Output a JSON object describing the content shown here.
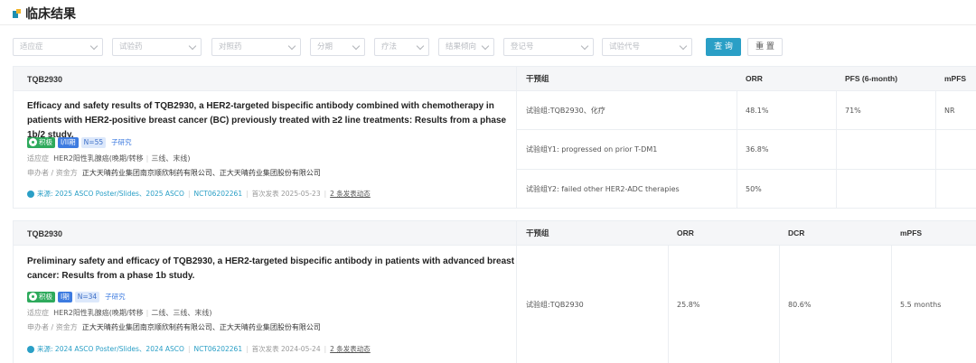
{
  "page": {
    "title": "临床结果"
  },
  "filters": [
    {
      "placeholder": "适应症"
    },
    {
      "placeholder": "试验药"
    },
    {
      "placeholder": "对照药"
    },
    {
      "placeholder": "分期"
    },
    {
      "placeholder": "疗法"
    },
    {
      "placeholder": "结果倾向"
    },
    {
      "placeholder": "登记号"
    },
    {
      "placeholder": "试验代号"
    }
  ],
  "buttons": {
    "query": "查 询",
    "reset": "重 置"
  },
  "cards": [
    {
      "drug": "TQB2930",
      "title": "Efficacy and safety results of TQB2930, a HER2-targeted bispecific antibody combined with chemotherapy in patients with HER2-positive breast cancer (BC) previously treated with ≥2 line treatments: Results from a phase 1b/2 study.",
      "tags": [
        "积极",
        "I/II期",
        "N=55",
        "子研究"
      ],
      "indication_label": "适应症",
      "indication": "HER2阳性乳腺癌(晚期/转移",
      "lines": "三线、末线)",
      "sponsor_label": "申办者 / 资金方",
      "sponsor": "正大天晴药业集团南京顺欣制药有限公司、正大天晴药业集团股份有限公司",
      "source_label": "来源:",
      "source": "2025 ASCO Poster/Slides、2025 ASCO",
      "registry": "NCT06202261",
      "first_pub_label": "首次发表",
      "first_pub_date": "2025-05-23",
      "updates": "2 条发表动态",
      "table": {
        "headers": [
          "干预组",
          "ORR",
          "PFS (6-month)",
          "mPFS"
        ],
        "rows": [
          [
            "试验组:TQB2930、化疗",
            "48.1%",
            "71%",
            "NR"
          ],
          [
            "试验组Y1: progressed on prior T-DM1",
            "36.8%",
            "",
            ""
          ],
          [
            "试验组Y2: failed other HER2-ADC therapies",
            "50%",
            "",
            ""
          ]
        ]
      }
    },
    {
      "drug": "TQB2930",
      "title": "Preliminary safety and efficacy of TQB2930, a HER2-targeted bispecific antibody in patients with advanced breast cancer: Results from a phase 1b study.",
      "tags": [
        "积极",
        "I期",
        "N=34",
        "子研究"
      ],
      "indication_label": "适应症",
      "indication": "HER2阳性乳腺癌(晚期/转移",
      "lines": "二线、三线、末线)",
      "sponsor_label": "申办者 / 资金方",
      "sponsor": "正大天晴药业集团南京顺欣制药有限公司、正大天晴药业集团股份有限公司",
      "source_label": "来源:",
      "source": "2024 ASCO Poster/Slides、2024 ASCO",
      "registry": "NCT06202261",
      "first_pub_label": "首次发表",
      "first_pub_date": "2024-05-24",
      "updates": "2 条发表动态",
      "table": {
        "headers": [
          "干预组",
          "ORR",
          "DCR",
          "mPFS"
        ],
        "rows": [
          [
            "试验组:TQB2930",
            "25.8%",
            "80.6%",
            "5.5 months"
          ]
        ]
      }
    }
  ],
  "colors": {
    "accent": "#2a9fc6",
    "positive": "#2eaa5c",
    "phase": "#3d7be0"
  }
}
